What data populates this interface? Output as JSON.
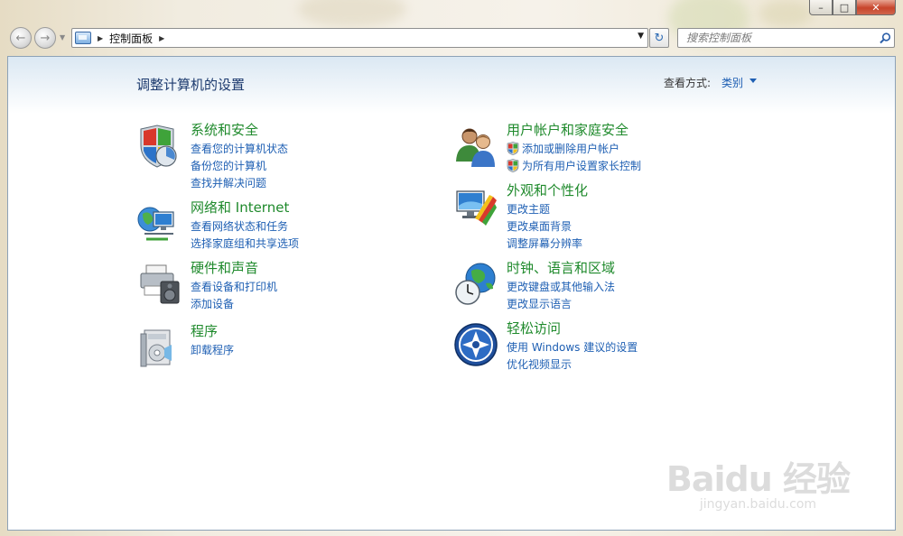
{
  "window": {
    "minimize_label": "–",
    "maximize_label": "□",
    "close_label": "✕"
  },
  "nav": {
    "back_glyph": "←",
    "forward_glyph": "→",
    "breadcrumb": "控制面板",
    "refresh_glyph": "↻",
    "search_placeholder": "搜索控制面板"
  },
  "header": {
    "title": "调整计算机的设置",
    "view_by_label": "查看方式:",
    "view_by_value": "类别"
  },
  "categories": [
    {
      "title": "系统和安全",
      "icon": "system-security-icon",
      "links": [
        "查看您的计算机状态",
        "备份您的计算机",
        "查找并解决问题"
      ]
    },
    {
      "title": "网络和 Internet",
      "icon": "network-icon",
      "links": [
        "查看网络状态和任务",
        "选择家庭组和共享选项"
      ]
    },
    {
      "title": "硬件和声音",
      "icon": "hardware-sound-icon",
      "links": [
        "查看设备和打印机",
        "添加设备"
      ]
    },
    {
      "title": "程序",
      "icon": "programs-icon",
      "links": [
        "卸载程序"
      ]
    },
    {
      "title": "用户帐户和家庭安全",
      "icon": "user-accounts-icon",
      "links": [
        "添加或删除用户帐户",
        "为所有用户设置家长控制"
      ],
      "link_icons": [
        "shield-icon",
        "shield-icon"
      ]
    },
    {
      "title": "外观和个性化",
      "icon": "appearance-icon",
      "links": [
        "更改主题",
        "更改桌面背景",
        "调整屏幕分辨率"
      ]
    },
    {
      "title": "时钟、语言和区域",
      "icon": "clock-language-region-icon",
      "links": [
        "更改键盘或其他输入法",
        "更改显示语言"
      ]
    },
    {
      "title": "轻松访问",
      "icon": "ease-of-access-icon",
      "links": [
        "使用 Windows 建议的设置",
        "优化视频显示"
      ]
    }
  ],
  "watermark": {
    "logo": "Baidu 经验",
    "url": "jingyan.baidu.com"
  },
  "colors": {
    "link": "#1e5fb3",
    "category_title": "#1f8a2c",
    "page_title": "#1c3a6e"
  }
}
